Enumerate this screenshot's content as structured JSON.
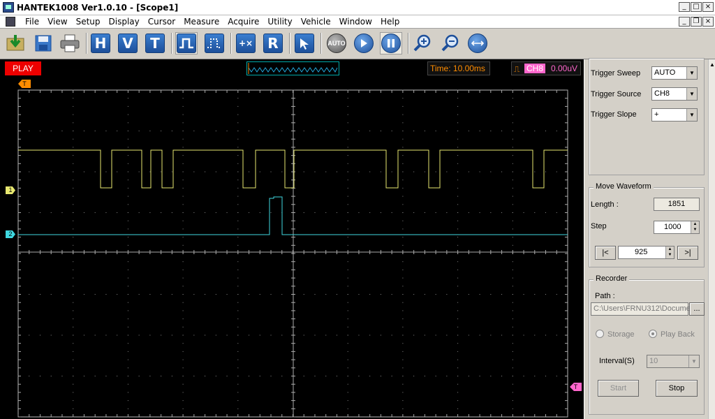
{
  "window": {
    "title": "HANTEK1008 Ver1.0.10 - [Scope1]"
  },
  "menu": [
    "File",
    "View",
    "Setup",
    "Display",
    "Cursor",
    "Measure",
    "Acquire",
    "Utility",
    "Vehicle",
    "Window",
    "Help"
  ],
  "toolbar": {
    "h_label": "H",
    "v_label": "V",
    "t_label": "T",
    "r_label": "R",
    "auto_label": "AUTO"
  },
  "scope": {
    "status": "PLAY",
    "time": "Time: 10.00ms",
    "trigger_channel": "CH8",
    "trigger_level": "0.00uV",
    "trigger_marker": "T",
    "ch1_marker": "1",
    "ch2_marker": "2",
    "colors": {
      "ch1": "#e8e870",
      "ch2": "#3fd8e0",
      "trigger": "#ff66cc",
      "time": "#ff8c00"
    }
  },
  "panel": {
    "trigger": {
      "sweep_label": "Trigger Sweep",
      "sweep_value": "AUTO",
      "source_label": "Trigger Source",
      "source_value": "CH8",
      "slope_label": "Trigger Slope",
      "slope_value": "+"
    },
    "move": {
      "title": "Move Waveform",
      "length_label": "Length :",
      "length_value": "1851",
      "step_label": "Step",
      "step_value": "1000",
      "first_label": "|<",
      "last_label": ">|",
      "position_value": "925"
    },
    "recorder": {
      "title": "Recorder",
      "path_label": "Path :",
      "path_value": "C:\\Users\\FRNU312\\Docume",
      "browse_label": "...",
      "storage_label": "Storage",
      "playback_label": "Play Back",
      "interval_label": "Interval(S)",
      "interval_value": "10",
      "start_label": "Start",
      "stop_label": "Stop"
    }
  }
}
